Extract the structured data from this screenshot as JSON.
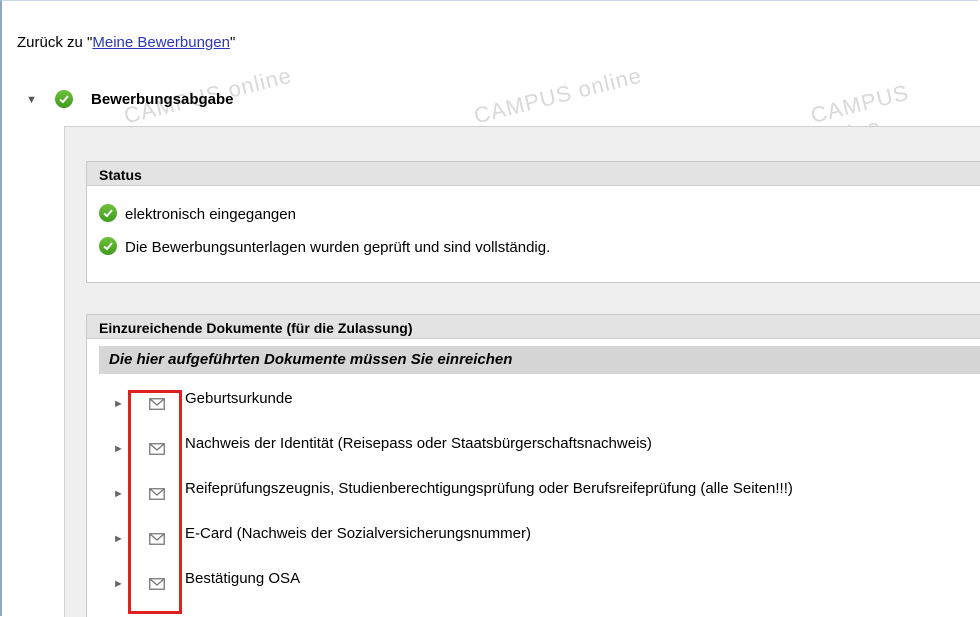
{
  "back": {
    "prefix": "Zurück zu \"",
    "link": "Meine Bewerbungen",
    "suffix": "\""
  },
  "section": {
    "title": "Bewerbungsabgabe"
  },
  "watermark": {
    "text": "CAMPUS online"
  },
  "status": {
    "heading": "Status",
    "items": [
      "elektronisch eingegangen",
      "Die Bewerbungsunterlagen wurden geprüft und sind vollständig."
    ]
  },
  "documents": {
    "heading": "Einzureichende Dokumente (für die Zulassung)",
    "subheading": "Die hier aufgeführten Dokumente müssen Sie einreichen",
    "items": [
      "Geburtsurkunde",
      "Nachweis der Identität (Reisepass oder Staatsbürgerschaftsnachweis)",
      "Reifeprüfungszeugnis, Studienberechtigungsprüfung oder Berufsreifeprüfung (alle Seiten!!!)",
      "E-Card (Nachweis der Sozialversicherungsnummer)",
      "Bestätigung OSA"
    ]
  },
  "colors": {
    "link": "#2a37b8",
    "check": "#4fac26",
    "highlight": "#e02020"
  }
}
